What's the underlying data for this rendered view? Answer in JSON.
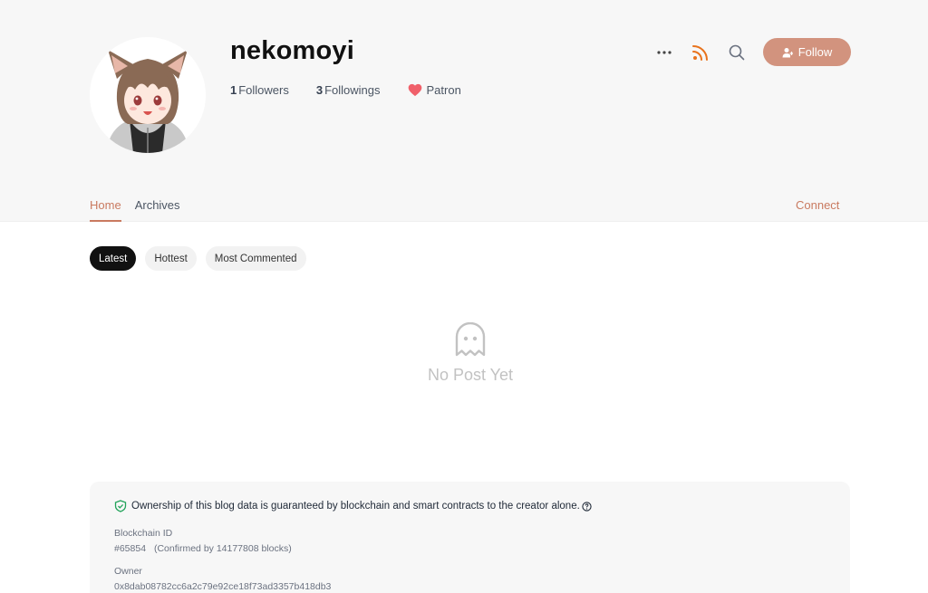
{
  "profile": {
    "username": "nekomoyi",
    "followers_count": "1",
    "followers_label": "Followers",
    "followings_count": "3",
    "followings_label": "Followings",
    "patron_label": "Patron"
  },
  "actions": {
    "more_icon": "more-dots-icon",
    "rss_icon": "rss-icon",
    "search_icon": "search-icon",
    "follow_label": "Follow"
  },
  "nav": {
    "items": [
      {
        "label": "Home",
        "active": true
      },
      {
        "label": "Archives",
        "active": false
      }
    ],
    "connect_label": "Connect"
  },
  "sort_tabs": [
    {
      "label": "Latest",
      "active": true
    },
    {
      "label": "Hottest",
      "active": false
    },
    {
      "label": "Most Commented",
      "active": false
    }
  ],
  "empty_state": {
    "icon": "ghost-icon",
    "message": "No Post Yet"
  },
  "blockchain": {
    "note": "Ownership of this blog data is guaranteed by blockchain and smart contracts to the creator alone.",
    "id_label": "Blockchain ID",
    "id_value": "#65854",
    "confirmation": "(Confirmed by 14177808 blocks)",
    "owner_label": "Owner",
    "owner_value": "0x8dab08782cc6a2c79e92ce18f73ad3357b418db3"
  },
  "colors": {
    "accent": "#c97a60",
    "follow_bg": "#d2937e",
    "rss": "#e8731d",
    "heart": "#f0606a",
    "shield": "#22a35a"
  }
}
